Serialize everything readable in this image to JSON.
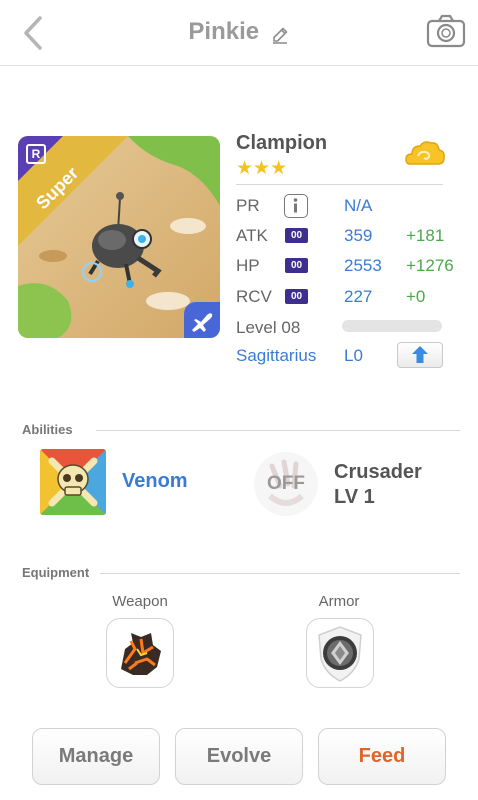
{
  "header": {
    "title": "Pinkie",
    "back_icon": "chevron-left-icon",
    "edit_icon": "pencil-icon",
    "camera_icon": "camera-icon"
  },
  "monster": {
    "card_label": "Super",
    "rarity_badge": "R",
    "name": "Clampion",
    "stars": "★★★",
    "star_count": 3,
    "element_icon": "cloud-icon",
    "class_icon": "airplane-icon"
  },
  "stats": {
    "pr": {
      "label": "PR",
      "value": "N/A",
      "icon": "info-icon"
    },
    "atk": {
      "label": "ATK",
      "badge": "00",
      "value": "359",
      "bonus": "+181"
    },
    "hp": {
      "label": "HP",
      "badge": "00",
      "value": "2553",
      "bonus": "+1276"
    },
    "rcv": {
      "label": "RCV",
      "badge": "00",
      "value": "227",
      "bonus": "+0"
    },
    "level": {
      "label": "Level 08",
      "progress": 0
    },
    "zodiac": {
      "name": "Sagittarius",
      "level": "L0",
      "upgrade_icon": "arrow-up-icon"
    }
  },
  "abilities": {
    "title": "Abilities",
    "items": [
      {
        "name": "Venom",
        "icon": "skull-crossbones-icon"
      },
      {
        "name": "Crusader",
        "level": "LV 1",
        "state": "OFF",
        "icon": "claw-icon"
      }
    ]
  },
  "equipment": {
    "title": "Equipment",
    "slots": [
      {
        "label": "Weapon",
        "icon": "lava-rock-icon"
      },
      {
        "label": "Armor",
        "icon": "shield-icon"
      }
    ]
  },
  "actions": {
    "manage": "Manage",
    "evolve": "Evolve",
    "feed": "Feed"
  },
  "colors": {
    "accent_blue": "#3a7bd5",
    "bonus_green": "#4aa84a",
    "feed_orange": "#e0652a",
    "star_yellow": "#f5c320",
    "badge_purple": "#3e2f8f"
  }
}
